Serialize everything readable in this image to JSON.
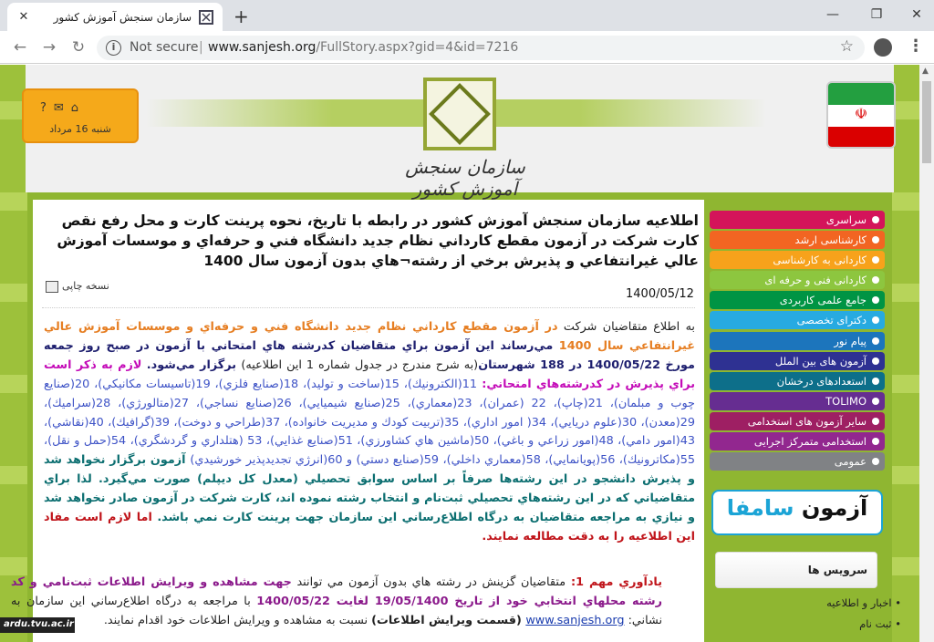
{
  "browser": {
    "tab_title": "سازمان سنجش آموزش کشور",
    "new_tab": "+",
    "security_label": "Not secure",
    "url_host": "www.sanjesh.org",
    "url_path": "/FullStory.aspx?gid=4&id=7216"
  },
  "header": {
    "logo_text": "سازمان سنجش آموزش کشور",
    "date_text": "شنبه 16 مرداد"
  },
  "article": {
    "title": "اطلاعيه سازمان سنجش آموزش كشور در رابطه با تاريخ، نحوه پرينت كارت و محل رفع نقص كارت شركت در آزمون مقطع كارداني نظام جديد دانشگاه فني و حرفه‌اي و موسسات آموزش عالي غيرانتفاعي و پذيرش برخي از رشته¬هاي بدون آزمون سال 1400",
    "print_label": "نسخه چاپی",
    "date": "1400/05/12",
    "p1_a": "به اطلاع متقاضيان شركت ",
    "p1_b": "در آزمون مقطع كارداني نظام جديد دانشگاه فني و حرفه‌اي و موسسات آموزش عالي غيرانتفاعي سال 1400",
    "p1_c": " مي‌رساند اين آزمون براي متقاضيان كدرشته هاي امتحاني با آزمون در صبح روز جمعه مورخ 1400/05/22 در 188 شهرستان",
    "p1_d": "(به شرح مندرج در جدول شماره 1 اين اطلاعيه)",
    "p1_e": " برگزار مي‌شود. ",
    "p1_f": "لازم به ذكر است براي پذيرش در كدرشته‌هاي امتحاني: ",
    "p1_g": "11(الكترونيك)، 15(ساخت و توليد)، 18(صنايع فلزي)، 19(تاسيسات مكانيكي)، 20(صنايع چوب و مبلمان)، 21(چاپ)، 22 (عمران)، 23(معماري)، 25(صنايع شيميايي)، 26(صنايع نساجي)، 27(متالورژي)، 28(سراميك)، 29(معدن)، 30(علوم دريايي)، 34( امور اداري)، 35(تربيت كودك و مديريت خانواده)، 37(طراحي و دوخت)، 39(گرافيك)، 40(نقاشي)، 43(امور دامي)، 48(امور زراعي و باغي)، 50(ماشين هاي كشاورزي)، 51(صنايع غذايي)، 53 (هتلداري و گردشگري)، 54(حمل و نقل)، 55(مكاترونيك)، 56(پويانمايي)، 58(معماري داخلي)، 59(صنايع دستي) و 60(انرژي تجديدپذير خورشيدي)",
    "p1_h": " آزمون برگزار نخواهد شد و پذيرش دانشجو در اين رشته‌ها صرفاً بر اساس سوابق تحصيلي (معدل كل ديپلم) صورت مي‌گيرد. لذا براي متقاضياني كه در اين رشته‌هاي تحصيلي ثبت‌نام و انتخاب رشته نموده اند، كارت شركت در آزمون صادر نخواهد شد و نيازي به مراجعه متقاضيان به درگاه اطلاع‌رساني اين سازمان جهت پرينت كارت نمي باشد. ",
    "p1_i": "اما لازم است مفاد اين اطلاعيه را به دقت مطالعه نمايند.",
    "p2_a": "يادآوري مهم 1: ",
    "p2_b": "متقاضيان گزينش در رشته هاي بدون آزمون مي توانند ",
    "p2_c": "جهت مشاهده و ويرايش اطلاعات ثبت‌نامي و كد رشته محلهاي انتخابي خود از تاريخ 19/05/1400 لغايت 1400/05/22",
    "p2_d": " با مراجعه به درگاه اطلاع‌رساني اين سازمان به نشاني: ",
    "p2_link": "www.sanjesh.org",
    "p2_e": " (قسمت ويرايش اطلاعات)",
    "p2_f": " نسبت به مشاهده و ويرايش اطلاعات خود اقدام نمايند."
  },
  "sidebar": {
    "items": [
      {
        "label": "سراسری",
        "color": "#d4145a"
      },
      {
        "label": "کارشناسی ارشد",
        "color": "#f26522"
      },
      {
        "label": "کاردانی به کارشناسی",
        "color": "#f7a21b"
      },
      {
        "label": "کاردانی فنی و حرفه ای",
        "color": "#8dc63f"
      },
      {
        "label": "جامع علمی کاربردی",
        "color": "#009444"
      },
      {
        "label": "دکترای تخصصی",
        "color": "#27aae1"
      },
      {
        "label": "پیام نور",
        "color": "#1c75bc"
      },
      {
        "label": "آزمون های بین الملل",
        "color": "#2e3192"
      },
      {
        "label": "استعدادهای درخشان",
        "color": "#0d6f8a"
      },
      {
        "label": "TOLIMO",
        "color": "#662d91"
      },
      {
        "label": "سایر آزمون های استخدامی",
        "color": "#9e1f63"
      },
      {
        "label": "استخدامی متمرکز اجرایی",
        "color": "#92278f"
      },
      {
        "label": "عمومی",
        "color": "#808285"
      }
    ],
    "banner_a": "آزمون",
    "banner_b": "سامفا",
    "services_title": "سرویس ها",
    "svc_1": "اخبار و اطلاعیه",
    "svc_2": "ثبت نام"
  },
  "watermark": "ardu.tvu.ac.ir"
}
